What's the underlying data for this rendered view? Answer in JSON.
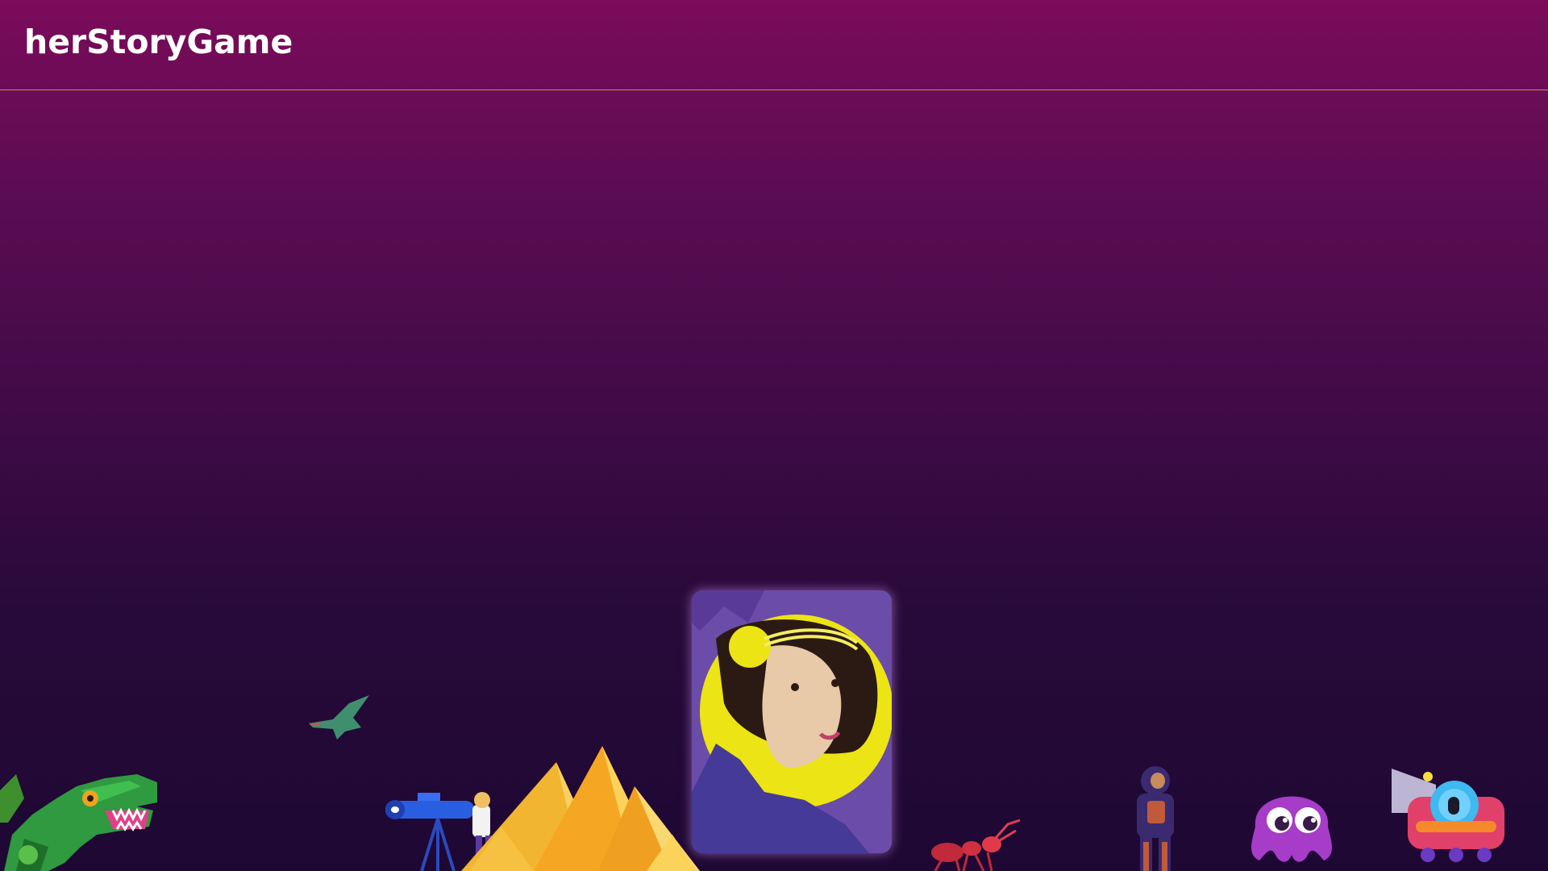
{
  "header": {
    "title": "herStoryGame"
  },
  "scene": {
    "characters": [
      {
        "name": "dinosaur"
      },
      {
        "name": "pterodactyl"
      },
      {
        "name": "astronomer"
      },
      {
        "name": "pyramids"
      },
      {
        "name": "ada-lovelace-portrait"
      },
      {
        "name": "ant"
      },
      {
        "name": "astronaut"
      },
      {
        "name": "octopus"
      },
      {
        "name": "submarine"
      }
    ]
  },
  "colors": {
    "background_top": "#7b0b5b",
    "background_bottom": "#1e0833",
    "header_border": "#c98a5c",
    "title_text": "#ffffff"
  }
}
